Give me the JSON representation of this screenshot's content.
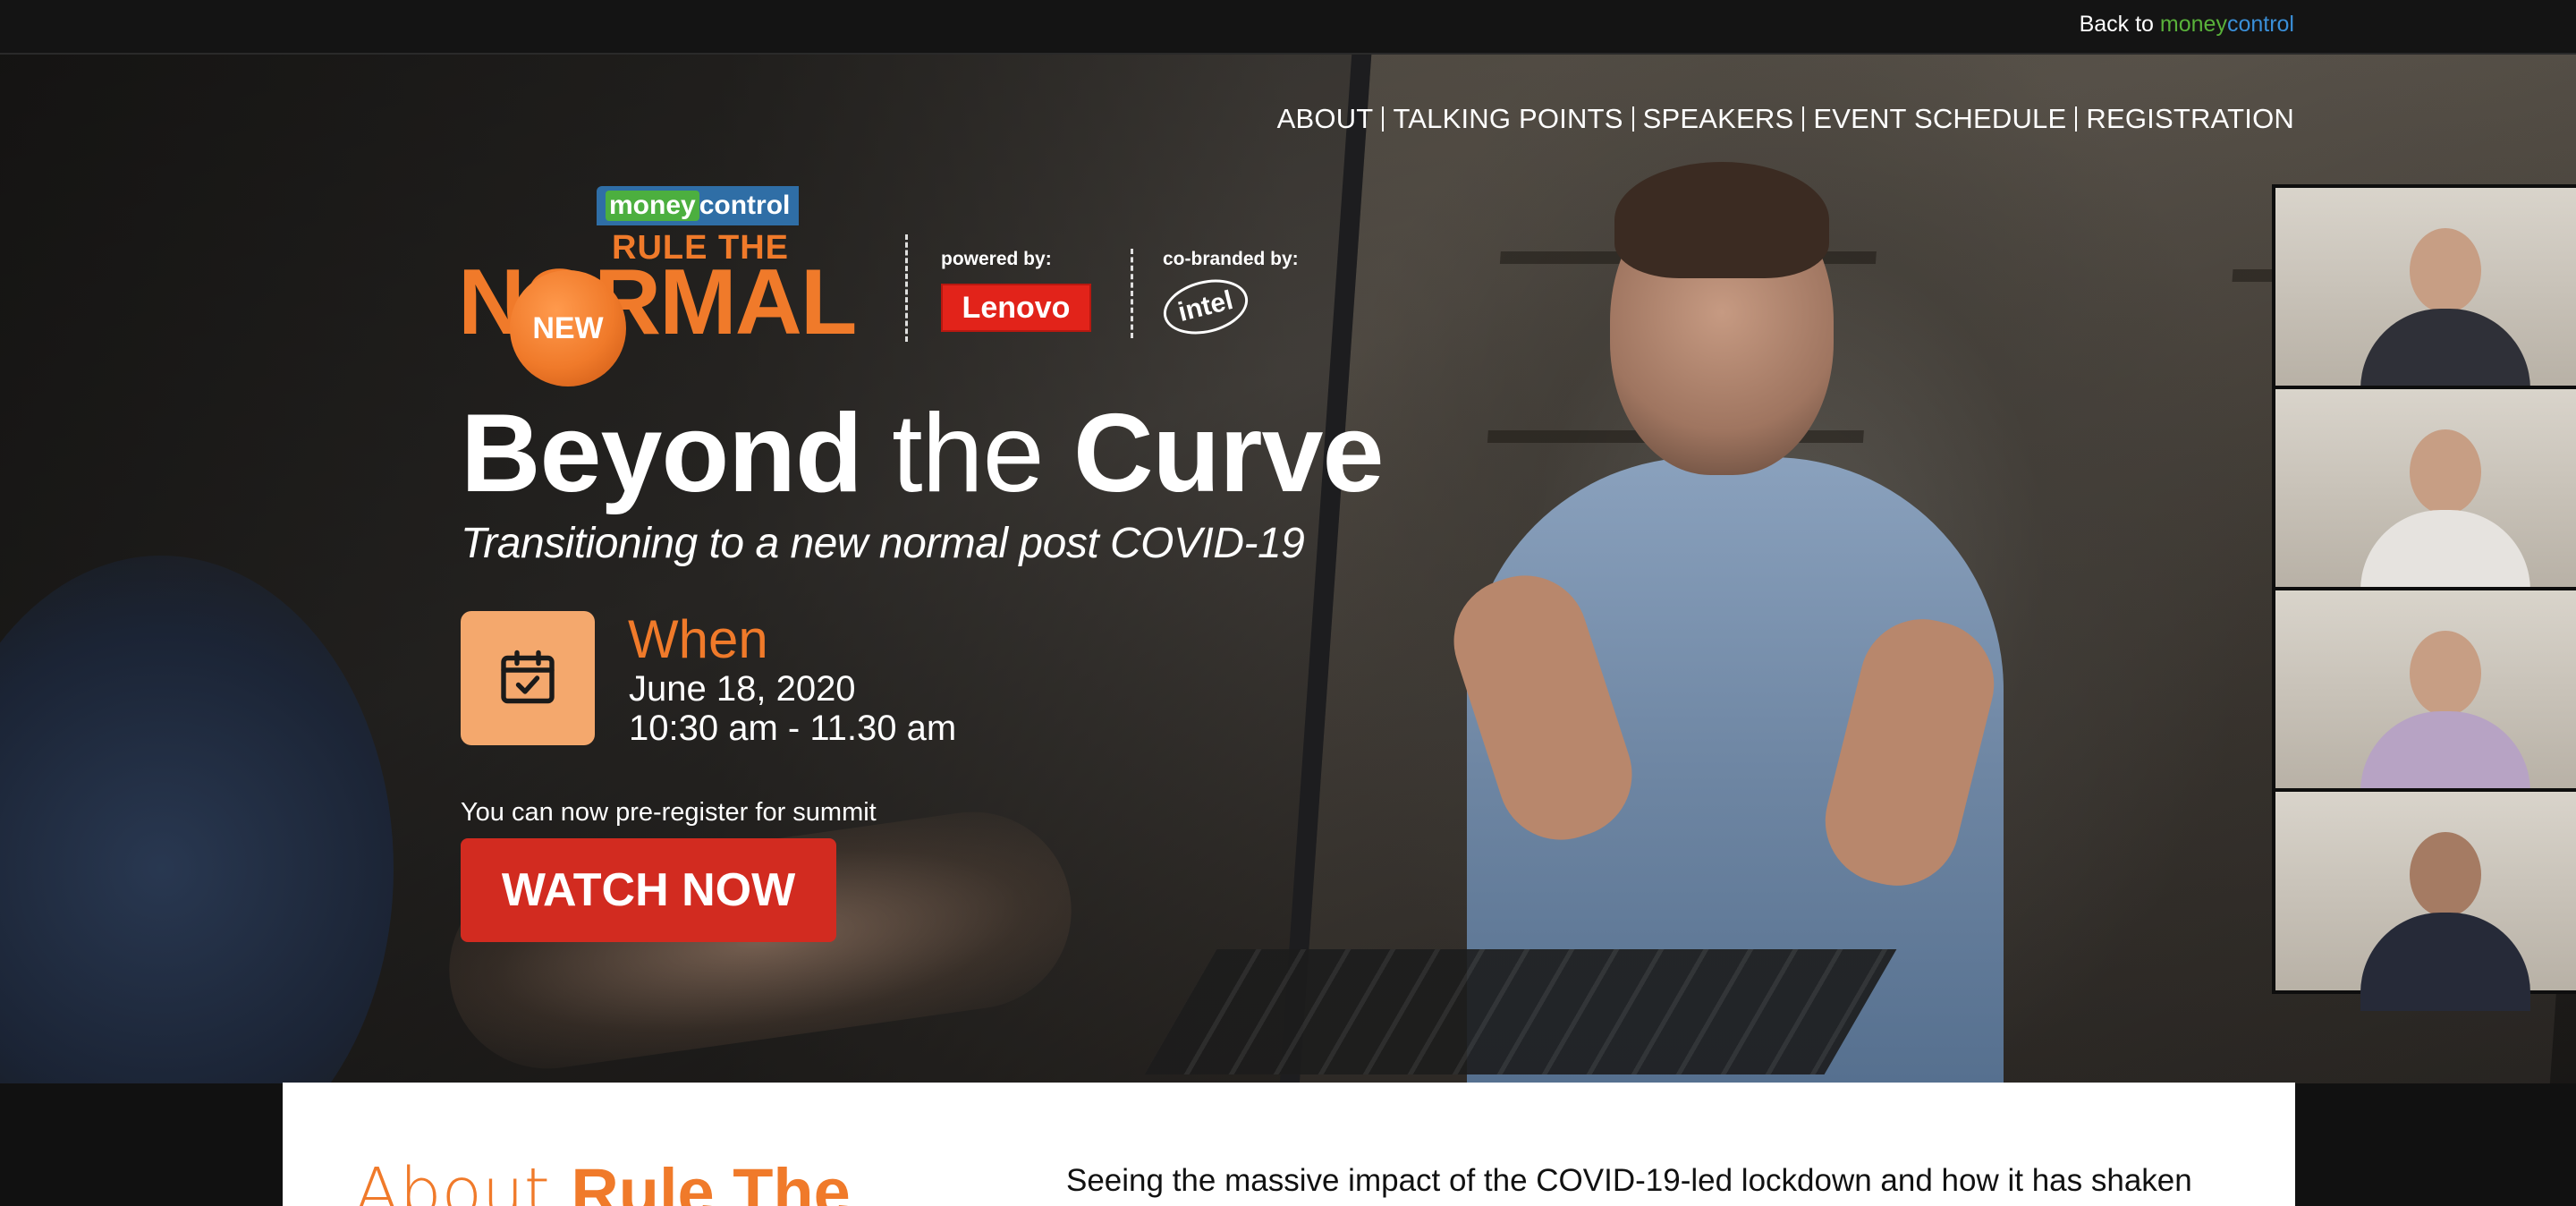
{
  "topbar": {
    "back_prefix": "Back to ",
    "brand_money": "money",
    "brand_control": "control"
  },
  "nav": {
    "items": [
      {
        "label": "ABOUT"
      },
      {
        "label": "TALKING POINTS"
      },
      {
        "label": "SPEAKERS"
      },
      {
        "label": "EVENT SCHEDULE"
      },
      {
        "label": "REGISTRATION"
      }
    ]
  },
  "logo": {
    "badge_money": "money",
    "badge_control": "control",
    "rule_the": "RULE THE",
    "normal": "NORMAL",
    "new": "NEW",
    "powered_by": "powered by:",
    "lenovo": "Lenovo",
    "cobranded_by": "co-branded by:",
    "intel": "intel"
  },
  "hero": {
    "headline_part1": "Beyond ",
    "headline_part2": "the ",
    "headline_part3": "Curve",
    "subheadline": "Transitioning to a new normal post COVID-19",
    "when_label": "When",
    "when_date": "June 18, 2020",
    "when_time": "10:30 am - 11.30 am",
    "preregister_text": "You can now pre-register for summit",
    "cta_label": "WATCH NOW"
  },
  "about": {
    "title_thin": "About ",
    "title_bold": "Rule The",
    "text": "Seeing the massive impact of the COVID-19-led lockdown and how it has shaken"
  },
  "colors": {
    "accent_orange": "#f07a2a",
    "cta_red": "#d22b20",
    "calendar_bg": "#f4a86d",
    "mc_green": "#59b23a",
    "mc_blue": "#3a8fd8"
  },
  "icons": {
    "calendar": "calendar-check-icon"
  }
}
